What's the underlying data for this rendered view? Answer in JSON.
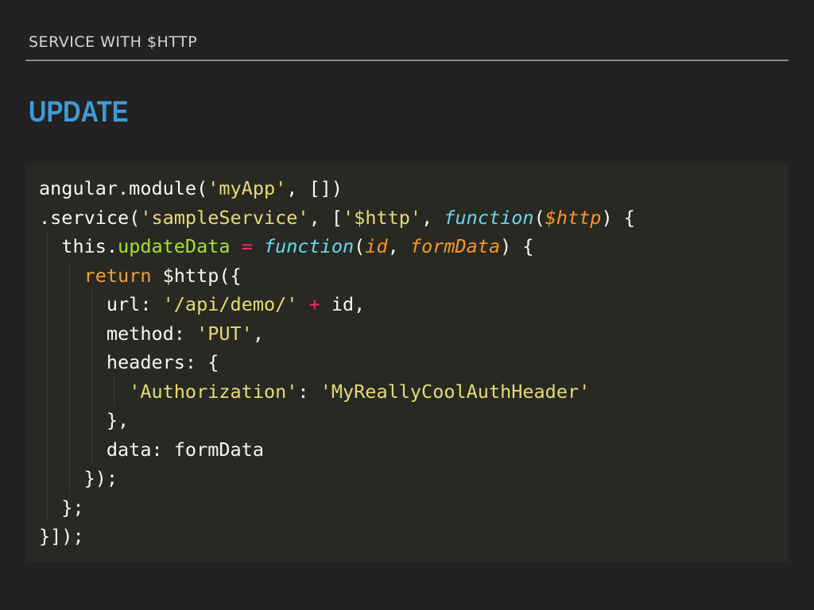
{
  "header": {
    "section": "SERVICE WITH $HTTP",
    "title": "UPDATE"
  },
  "code": {
    "l1": {
      "a": "angular.module(",
      "b": "'myApp'",
      "c": ", [])"
    },
    "l2": {
      "a": ".service(",
      "b": "'sampleService'",
      "c": ", [",
      "d": "'$http'",
      "e": ", ",
      "f": "function",
      "g": "(",
      "h": "$http",
      "i": ") {"
    },
    "l3": {
      "a": "  this.",
      "b": "updateData",
      "c": " = ",
      "d": "function",
      "e": "(",
      "f": "id",
      "g": ", ",
      "h": "formData",
      "i": ") {"
    },
    "l4": {
      "a": "    ",
      "b": "return",
      "c": " $http({"
    },
    "l5": {
      "a": "      url: ",
      "b": "'/api/demo/'",
      "c": " ",
      "d": "+",
      "e": " id,"
    },
    "l6": {
      "a": "      method: ",
      "b": "'PUT'",
      "c": ","
    },
    "l7": {
      "a": "      headers: {"
    },
    "l8": {
      "a": "        ",
      "b": "'Authorization'",
      "c": ": ",
      "d": "'MyReallyCoolAuthHeader'"
    },
    "l9": {
      "a": "      },"
    },
    "l10": {
      "a": "      data: formData"
    },
    "l11": {
      "a": "    });"
    },
    "l12": {
      "a": "  };"
    },
    "l13": {
      "a": "}]);"
    }
  },
  "colors": {
    "background": "#222222",
    "title": "#3f9bd6",
    "code_background": "#282923",
    "string": "#e6db74",
    "keyword_storage": "#66d9ef",
    "parameter": "#fd971f",
    "function_name": "#a6e22e",
    "operator": "#f92672"
  }
}
